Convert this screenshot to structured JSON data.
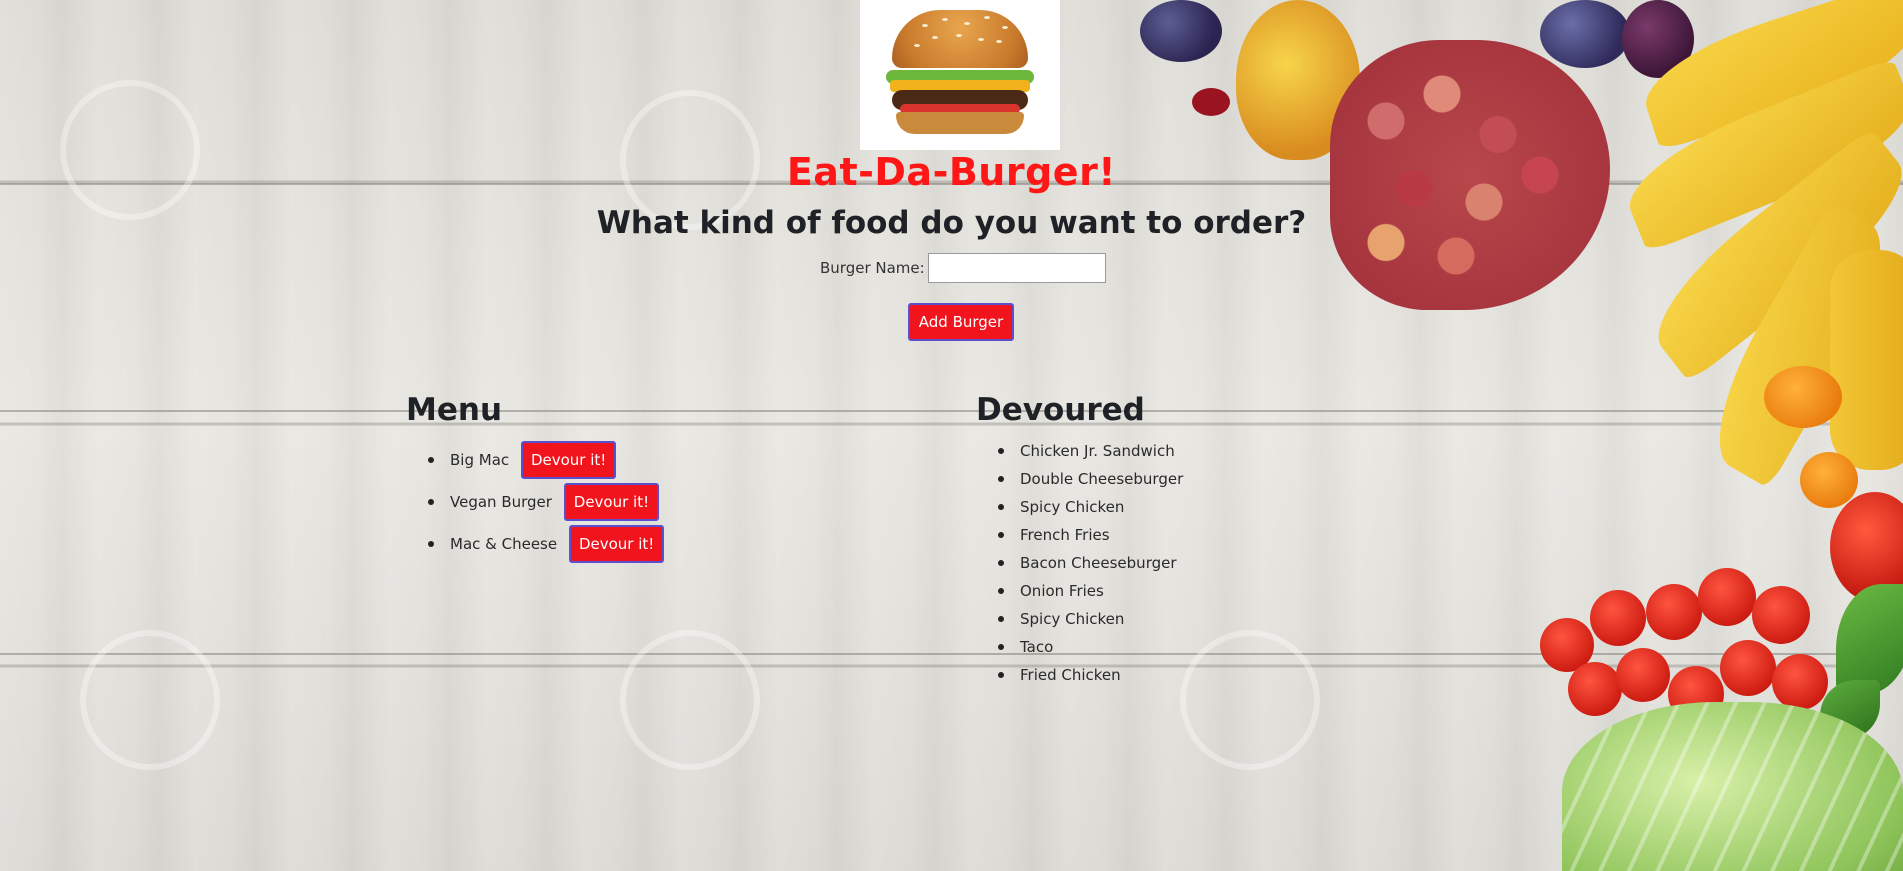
{
  "header": {
    "image_alt": "burger-image",
    "title": "Eat-Da-Burger!",
    "question": "What kind of food do you want to order?"
  },
  "form": {
    "label": "Burger Name:",
    "input_value": "",
    "add_button_label": "Add Burger"
  },
  "menu": {
    "heading": "Menu",
    "items": [
      {
        "name": "Big Mac",
        "button_label": "Devour it!"
      },
      {
        "name": "Vegan Burger",
        "button_label": "Devour it!"
      },
      {
        "name": "Mac & Cheese",
        "button_label": "Devour it!"
      }
    ]
  },
  "devoured": {
    "heading": "Devoured",
    "items": [
      "Chicken Jr. Sandwich",
      "Double Cheeseburger",
      "Spicy Chicken",
      "French Fries",
      "Bacon Cheeseburger",
      "Onion Fries",
      "Spicy Chicken",
      "Taco",
      "Fried Chicken"
    ]
  },
  "colors": {
    "accent_red": "#f2141c",
    "title_red": "#ff1717",
    "button_border": "#5a4fcf"
  }
}
